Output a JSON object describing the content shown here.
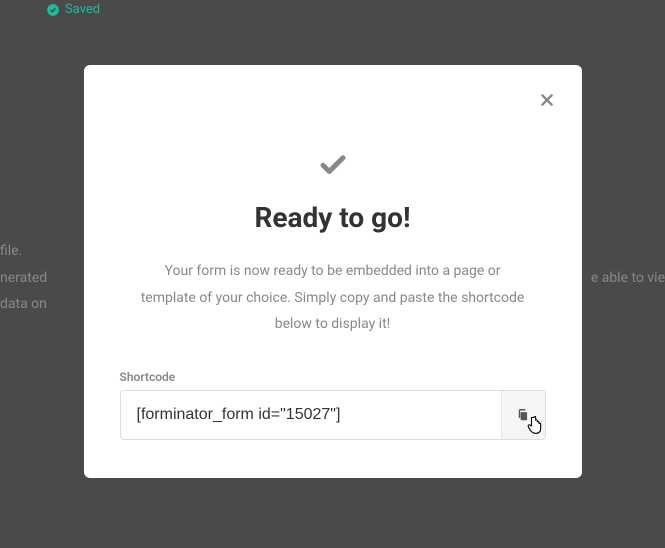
{
  "bg": {
    "saved": "Saved",
    "left_lines": [
      "file.",
      "nerated",
      "data on"
    ],
    "right_text": "e able to vie"
  },
  "modal": {
    "title": "Ready to go!",
    "description": "Your form is now ready to be embedded into a page or template of your choice. Simply copy and paste the shortcode below to display it!",
    "shortcode_label": "Shortcode",
    "shortcode_value": "[forminator_form id=\"15027\"]"
  }
}
